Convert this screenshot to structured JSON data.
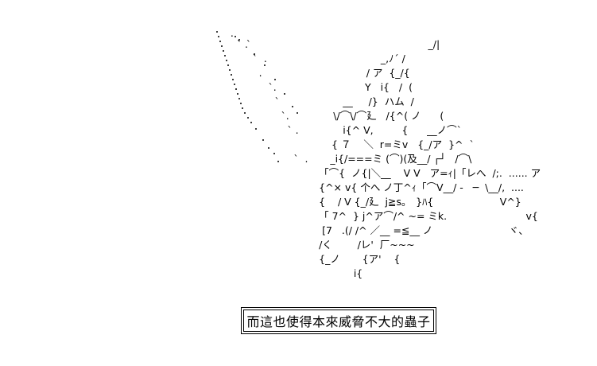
{
  "ascii_art": {
    "lines": [
      "     .",
      "       ` .",
      "          `                                                        _/|",
      "            `  .                                    _,ﾉ´ /",
      "              .                                 / ア  {_/{",
      "                 `.                            Y   i{   /  (",
      "                   `                    __     /}  ハム  /",
      "                     `.              \\/⌒\\/⌒廴   /{^( ノ      (",
      "                       ` .              i{^ V,         {      __ノ⌒`",
      "                                     { ７    ＼  r=ミv   {_/ア  }^  `",
      "                         `  .       _i{/===ミ (⌒)(及__/ ┌┘   /⌒\\",
      "                                 「⌒{  ノ{|＼__    V V   ア=ｨ|「レへ  /;.  ...... ア",
      "                                 {^× v{ 个へ ノ丁^ｨ「⌒V__/ -   ─  \\__/,  ....",
      "                                 {    / V {_/廴  j≧s｡   }ﾊ{                     V^}",
      "                                 「 7^  } j^ア⌒/^ ~= ミk.                         v{",
      "                                  [7   .(/ /^ ／__ =≦__ ノ                        ヾ、",
      "                                 /く        /レ'  厂~~~",
      "                                 {_ノ       {ア'    {",
      "                                            i{"
    ]
  },
  "caption": {
    "text": "而這也使得本來威脅不大的蟲子"
  }
}
